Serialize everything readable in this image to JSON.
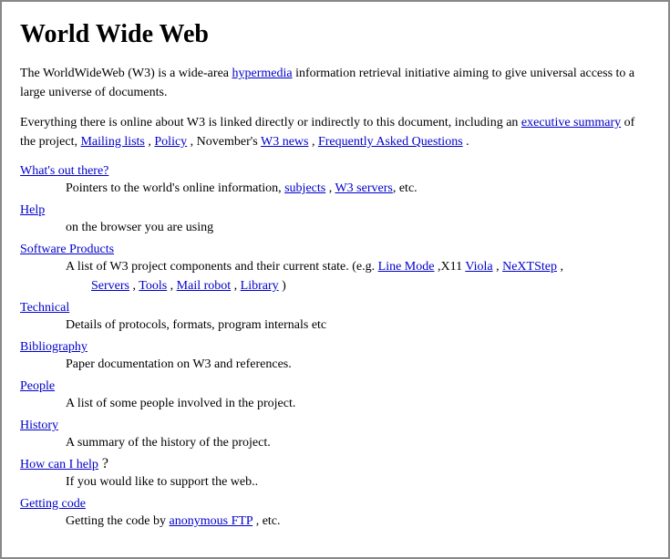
{
  "title": "World Wide Web",
  "intro_paragraph1": "The WorldWideWeb (W3) is a wide-area ",
  "intro_link1": "hypermedia",
  "intro_para1_cont": " information retrieval initiative aiming to give universal access to a large universe of documents.",
  "intro_paragraph2_start": "Everything there is online about W3 is linked directly or indirectly to this document, including an ",
  "intro_link_exec": "executive summary",
  "intro_para2_mid": " of the project, ",
  "intro_link_mail": "Mailing lists",
  "intro_para2_2": " , ",
  "intro_link_policy": "Policy",
  "intro_para2_3": " , November's ",
  "intro_link_w3news": "W3 news",
  "intro_para2_4": " , ",
  "intro_link_faq": "Frequently Asked Questions",
  "intro_para2_end": " .",
  "sections": [
    {
      "link": "What's out there?",
      "desc_start": "Pointers to the world's online information, ",
      "desc_links": [
        {
          "text": "subjects",
          "sep": " , "
        },
        {
          "text": "W3 servers",
          "sep": ""
        }
      ],
      "desc_end": ", etc."
    },
    {
      "link": "Help",
      "desc_start": "on the browser you are using",
      "desc_links": [],
      "desc_end": ""
    },
    {
      "link": "Software Products",
      "desc_start": "A list of W3 project components and their current state. (e.g. ",
      "desc_links": [
        {
          "text": "Line Mode",
          "sep": " ,X11 "
        },
        {
          "text": "Viola",
          "sep": " , "
        },
        {
          "text": "NeXTStep",
          "sep": " , "
        },
        {
          "text": "Servers",
          "sep": " , "
        },
        {
          "text": "Tools",
          "sep": " , "
        },
        {
          "text": "Mail robot",
          "sep": " , "
        },
        {
          "text": "Library",
          "sep": ""
        }
      ],
      "desc_end": " )"
    },
    {
      "link": "Technical",
      "desc_start": "Details of protocols, formats, program internals etc",
      "desc_links": [],
      "desc_end": ""
    },
    {
      "link": "Bibliography",
      "desc_start": "Paper documentation on W3 and references.",
      "desc_links": [],
      "desc_end": ""
    },
    {
      "link": "People",
      "desc_start": "A list of some people involved in the project.",
      "desc_links": [],
      "desc_end": ""
    },
    {
      "link": "History",
      "desc_start": "A summary of the history of the project.",
      "desc_links": [],
      "desc_end": ""
    },
    {
      "link": "How can I help",
      "desc_start": "If you would like to support the web..",
      "desc_links": [],
      "desc_end": "",
      "suffix": " ?"
    },
    {
      "link": "Getting code",
      "desc_start": "Getting the code by ",
      "desc_links": [
        {
          "text": "anonymous FTP",
          "sep": ""
        }
      ],
      "desc_end": " , etc."
    }
  ]
}
